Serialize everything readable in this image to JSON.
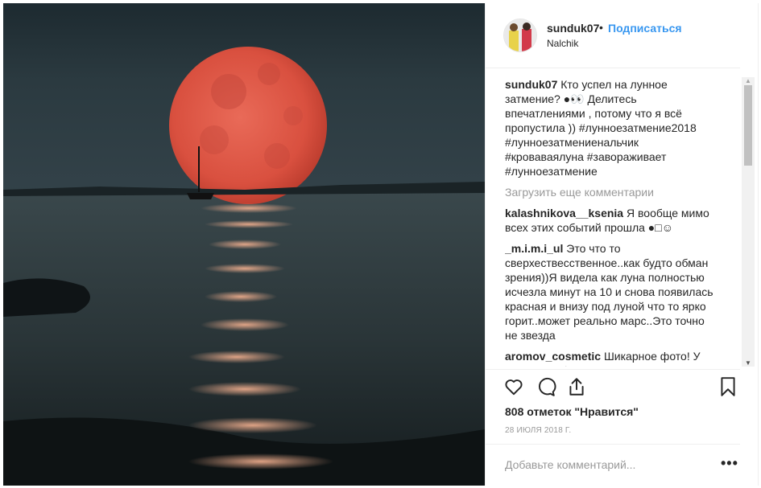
{
  "post": {
    "username": "sunduk07",
    "follow_label": "Подписаться",
    "separator": "•",
    "location": "Nalchik",
    "caption_author": "sunduk07",
    "caption_text": "Кто успел на лунное затмение? ●👀 Делитесь впечатлениями , потому что я всё пропустила )) #лунноезатмение2018 #лунноезатмениенальчик #кроваваялуна #завораживает #лунноезатмение",
    "load_more": "Загрузить еще комментарии",
    "comments": [
      {
        "author": "kalashnikova__ksenia",
        "text": "Я вообще мимо всех этих событий прошла ●□☺"
      },
      {
        "author": "_m.i.m.i_ul",
        "text": "Это что то сверхествесственное..как будто обман зрения))Я видела как луна полностью исчезла минут на 10 и снова появилась красная и внизу под луной что то ярко горит..может реально марс..Это точно не звезда"
      },
      {
        "author": "aromov_cosmetic",
        "text": "Шикарное фото! У нас тоже облака все скрыли((("
      }
    ],
    "likes": "808 отметок \"Нравится\"",
    "date": "28 ИЮЛЯ 2018 Г.",
    "add_comment_placeholder": "Добавьте комментарий...",
    "more_options": "•••"
  },
  "icons": {
    "like": "heart-icon",
    "comment": "comment-icon",
    "share": "share-icon",
    "save": "bookmark-icon"
  },
  "colors": {
    "link": "#3897f0",
    "text": "#262626",
    "muted": "#999999"
  }
}
